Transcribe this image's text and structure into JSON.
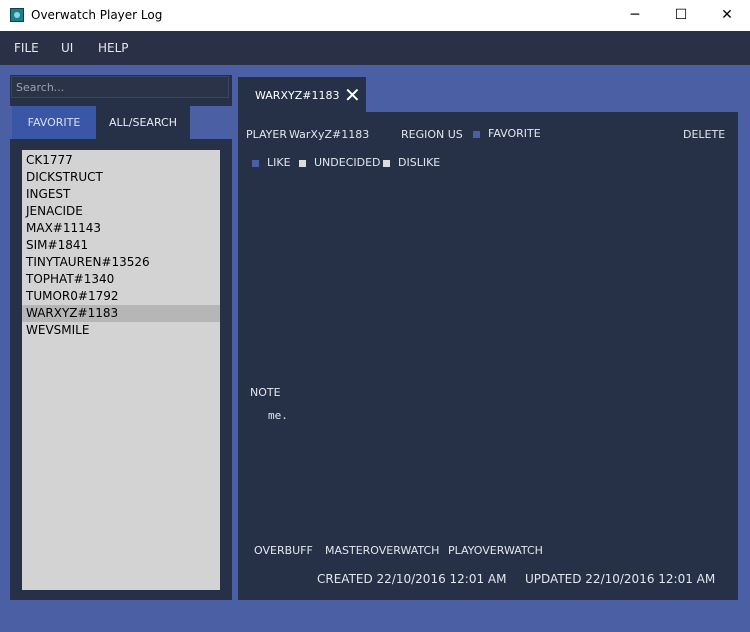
{
  "window": {
    "title": "Overwatch Player Log",
    "controls": {
      "minimize": "─",
      "maximize": "☐",
      "close": "✕"
    }
  },
  "menu": [
    "FILE",
    "UI",
    "HELP"
  ],
  "search": {
    "placeholder": "Search...",
    "value": ""
  },
  "list_tabs": [
    "FAVORITE",
    "ALL/SEARCH"
  ],
  "players": [
    "CK1777",
    "DICKSTRUCT",
    "INGEST",
    "JENACIDE",
    "MAX#11143",
    "SIM#1841",
    "TINYTAUREN#13526",
    "TOPHAT#1340",
    "TUMOR0#1792",
    "WARXYZ#1183",
    "WEVSMILE"
  ],
  "selected_player": "WARXYZ#1183",
  "doc_tab": {
    "label": "WARXYZ#1183",
    "close": "✕"
  },
  "detail": {
    "player_label": "PLAYER",
    "player_name": "WarXyZ#1183",
    "region_label": "REGION US",
    "favorite_label": "FAVORITE",
    "delete_label": "DELETE",
    "ratings": [
      "LIKE",
      "UNDECIDED",
      "DISLIKE"
    ],
    "note_label": "NOTE",
    "note_text": "me.",
    "links": [
      "OVERBUFF",
      "MASTEROVERWATCH",
      "PLAYOVERWATCH"
    ],
    "created": "CREATED 22/10/2016 12:01 AM",
    "updated": "UPDATED 22/10/2016 12:01 AM"
  },
  "colors": {
    "background": "#4a5fa4",
    "panel": "#263147",
    "menubar": "#2a3045",
    "list": "#d3d3d3",
    "selected_row": "#b6b6b6"
  }
}
